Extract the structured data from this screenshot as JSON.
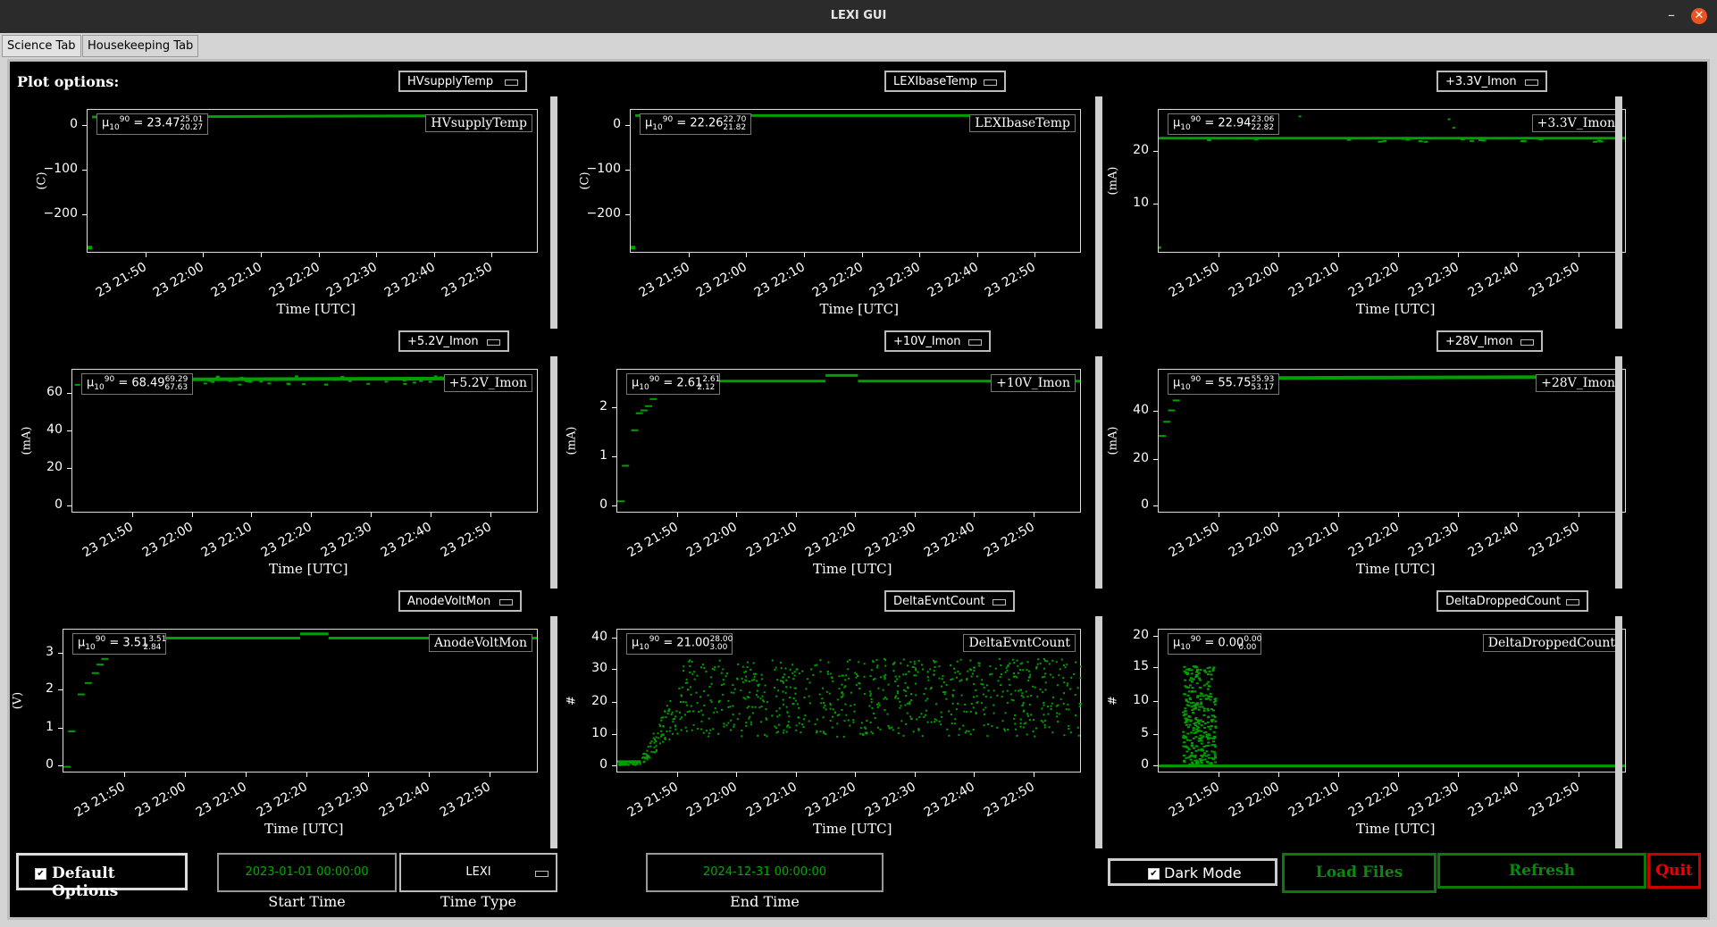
{
  "window": {
    "title": "LEXI GUI",
    "minimize_glyph": "–",
    "close_glyph": "✕"
  },
  "tabs": [
    {
      "label": "Science Tab"
    },
    {
      "label": "Housekeeping Tab"
    }
  ],
  "plot_options_label": "Plot options:",
  "colors": {
    "data": "#00a000",
    "background": "#000000",
    "accent_green": "#0a7a0a",
    "quit_red": "#e00000"
  },
  "plots": [
    {
      "selector": "HVsupplyTemp",
      "legend": "HVsupplyTemp",
      "mu": "23.47",
      "hi": "25.01",
      "lo": "20.27",
      "ylabel": "(C)",
      "yticks": [
        "0",
        "−100",
        "−200"
      ],
      "xticks": [
        "23 21:50",
        "23 22:00",
        "23 22:10",
        "23 22:20",
        "23 22:30",
        "23 22:40",
        "23 22:50"
      ],
      "xlabel": "Time [UTC]"
    },
    {
      "selector": "LEXIbaseTemp",
      "legend": "LEXIbaseTemp",
      "mu": "22.26",
      "hi": "22.70",
      "lo": "21.82",
      "ylabel": "(C)",
      "yticks": [
        "0",
        "−100",
        "−200"
      ],
      "xticks": [
        "23 21:50",
        "23 22:00",
        "23 22:10",
        "23 22:20",
        "23 22:30",
        "23 22:40",
        "23 22:50"
      ],
      "xlabel": "Time [UTC]"
    },
    {
      "selector": "+3.3V_Imon",
      "legend": "+3.3V_Imon",
      "mu": "22.94",
      "hi": "23.06",
      "lo": "22.82",
      "ylabel": "(mA)",
      "yticks": [
        "20",
        "10"
      ],
      "xticks": [
        "23 21:50",
        "23 22:00",
        "23 22:10",
        "23 22:20",
        "23 22:30",
        "23 22:40",
        "23 22:50"
      ],
      "xlabel": "Time [UTC]"
    },
    {
      "selector": "+5.2V_Imon",
      "legend": "+5.2V_Imon",
      "mu": "68.49",
      "hi": "69.29",
      "lo": "67.63",
      "ylabel": "(mA)",
      "yticks": [
        "60",
        "40",
        "20",
        "0"
      ],
      "xticks": [
        "23 21:50",
        "23 22:00",
        "23 22:10",
        "23 22:20",
        "23 22:30",
        "23 22:40",
        "23 22:50"
      ],
      "xlabel": "Time [UTC]"
    },
    {
      "selector": "+10V_Imon",
      "legend": "+10V_Imon",
      "mu": "2.61",
      "hi": "2.61",
      "lo": "2.12",
      "ylabel": "(mA)",
      "yticks": [
        "2",
        "1",
        "0"
      ],
      "xticks": [
        "23 21:50",
        "23 22:00",
        "23 22:10",
        "23 22:20",
        "23 22:30",
        "23 22:40",
        "23 22:50"
      ],
      "xlabel": "Time [UTC]"
    },
    {
      "selector": "+28V_Imon",
      "legend": "+28V_Imon",
      "mu": "55.75",
      "hi": "55.93",
      "lo": "53.17",
      "ylabel": "(mA)",
      "yticks": [
        "40",
        "20",
        "0"
      ],
      "xticks": [
        "23 21:50",
        "23 22:00",
        "23 22:10",
        "23 22:20",
        "23 22:30",
        "23 22:40",
        "23 22:50"
      ],
      "xlabel": "Time [UTC]"
    },
    {
      "selector": "AnodeVoltMon",
      "legend": "AnodeVoltMon",
      "mu": "3.51",
      "hi": "3.51",
      "lo": "2.84",
      "ylabel": "(V)",
      "yticks": [
        "3",
        "2",
        "1",
        "0"
      ],
      "xticks": [
        "23 21:50",
        "23 22:00",
        "23 22:10",
        "23 22:20",
        "23 22:30",
        "23 22:40",
        "23 22:50"
      ],
      "xlabel": "Time [UTC]"
    },
    {
      "selector": "DeltaEvntCount",
      "legend": "DeltaEvntCount",
      "mu": "21.00",
      "hi": "28.00",
      "lo": "3.00",
      "ylabel": "#",
      "yticks": [
        "40",
        "30",
        "20",
        "10",
        "0"
      ],
      "xticks": [
        "23 21:50",
        "23 22:00",
        "23 22:10",
        "23 22:20",
        "23 22:30",
        "23 22:40",
        "23 22:50"
      ],
      "xlabel": "Time [UTC]"
    },
    {
      "selector": "DeltaDroppedCount",
      "legend": "DeltaDroppedCount",
      "mu": "0.00",
      "hi": "0.00",
      "lo": "0.00",
      "ylabel": "#",
      "yticks": [
        "20",
        "15",
        "10",
        "5",
        "0"
      ],
      "xticks": [
        "23 21:50",
        "23 22:00",
        "23 22:10",
        "23 22:20",
        "23 22:30",
        "23 22:40",
        "23 22:50"
      ],
      "xlabel": "Time [UTC]"
    }
  ],
  "controls": {
    "default_options": "Default Options",
    "start_time": "2023-01-01 00:00:00",
    "start_time_caption": "Start Time",
    "time_type": "LEXI",
    "time_type_caption": "Time Type",
    "end_time": "2024-12-31 00:00:00",
    "end_time_caption": "End Time",
    "dark_mode": "Dark Mode",
    "load_files": "Load Files",
    "refresh": "Refresh",
    "quit": "Quit"
  }
}
